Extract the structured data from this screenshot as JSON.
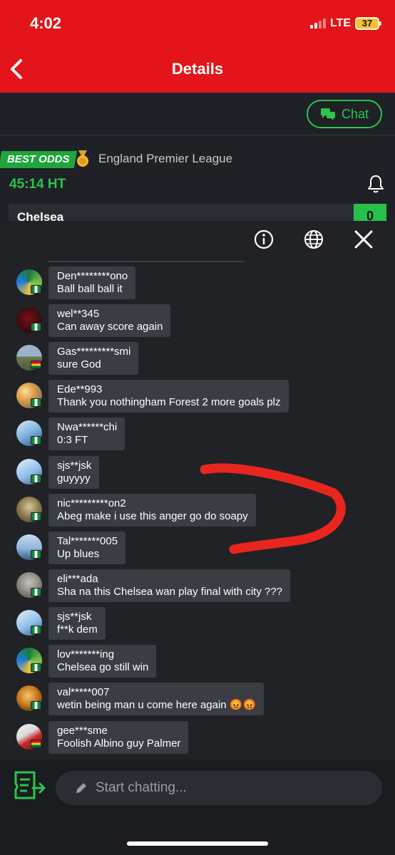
{
  "status_bar": {
    "time": "4:02",
    "network": "LTE",
    "battery": "37"
  },
  "header": {
    "title": "Details",
    "back_icon": "chevron-left-icon"
  },
  "chat_button": {
    "label": "Chat",
    "icon": "chat-bubbles-icon"
  },
  "match": {
    "badge": "BEST ODDS",
    "league": "England Premier League",
    "time": "45:14 HT",
    "team": "Chelsea",
    "score": "0"
  },
  "panel_icons": [
    "info-icon",
    "globe-icon",
    "close-icon"
  ],
  "messages": [
    {
      "user": "Den********ono",
      "text": "Ball ball ball it"
    },
    {
      "user": "wel**345",
      "text": "Can away score again"
    },
    {
      "user": "Gas*********smi",
      "text": "sure God"
    },
    {
      "user": "Ede**993",
      "text": "Thank you nothingham Forest 2 more goals plz"
    },
    {
      "user": "Nwa******chi",
      "text": "0:3 FT"
    },
    {
      "user": "sjs**jsk",
      "text": "guyyyy"
    },
    {
      "user": "nic*********on2",
      "text": "Abeg make i use this anger go do soapy"
    },
    {
      "user": "Tal*******005",
      "text": "Up blues"
    },
    {
      "user": "eli***ada",
      "text": "Sha na this Chelsea wan play final with city ???"
    },
    {
      "user": "sjs**jsk",
      "text": "f**k dem"
    },
    {
      "user": "lov*******ing",
      "text": "Chelsea go still win"
    },
    {
      "user": "val*****007",
      "text": "wetin being man u come here again 😡😡"
    },
    {
      "user": "gee***sme",
      "text": "Foolish Albino guy Palmer"
    }
  ],
  "input": {
    "placeholder": "Start chatting..."
  },
  "colors": {
    "header_red": "#e3141a",
    "accent_green": "#2cc44d",
    "annotation_red": "#e8261f"
  }
}
